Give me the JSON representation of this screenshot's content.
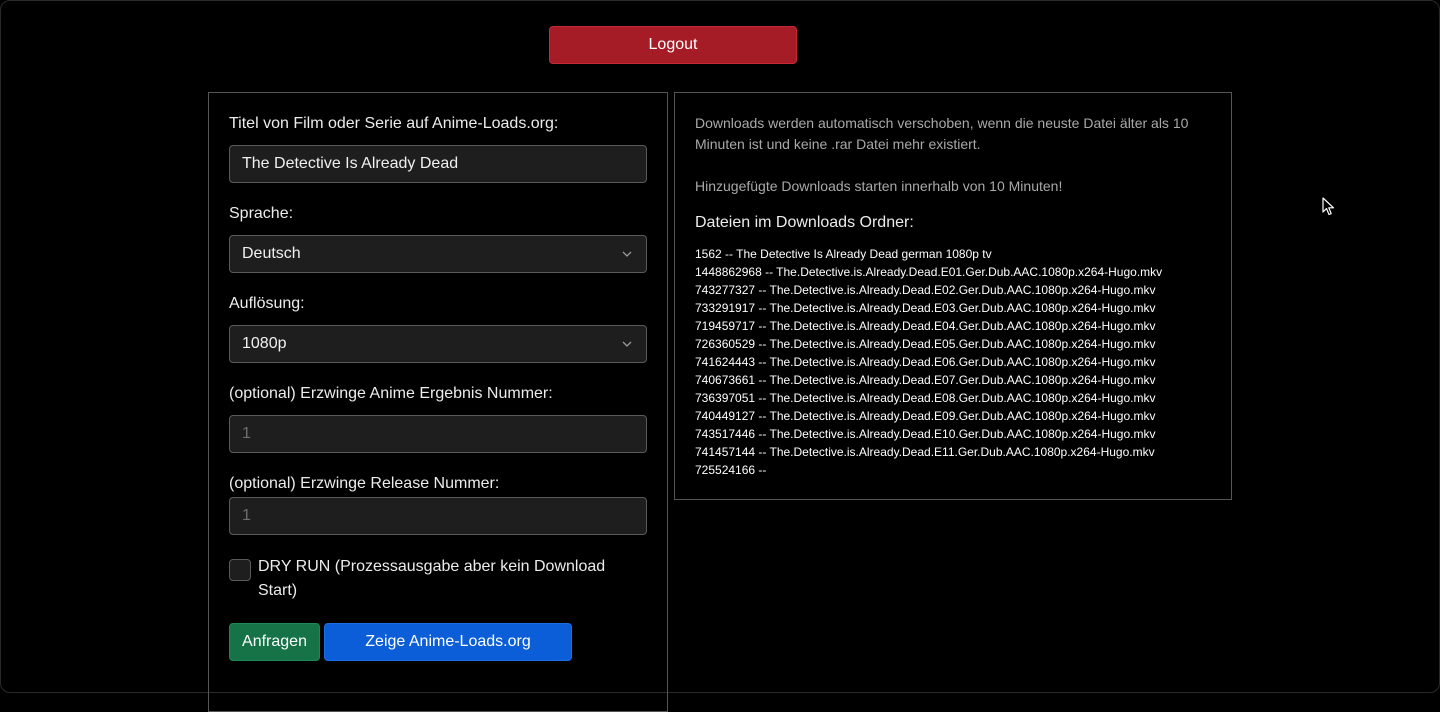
{
  "header": {
    "logout_label": "Logout"
  },
  "form": {
    "title_label": "Titel von Film oder Serie auf Anime-Loads.org:",
    "title_value": "The Detective Is Already Dead",
    "language_label": "Sprache:",
    "language_value": "Deutsch",
    "resolution_label": "Auflösung:",
    "resolution_value": "1080p",
    "anime_result_label": "(optional) Erzwinge Anime Ergebnis Nummer:",
    "anime_result_placeholder": "1",
    "release_label": "(optional) Erzwinge Release Nummer:",
    "release_placeholder": "1",
    "dry_run_label": "DRY RUN (Prozessausgabe aber kein Download Start)",
    "dry_run_checked": false,
    "submit_label": "Anfragen",
    "show_site_label": "Zeige Anime-Loads.org"
  },
  "info": {
    "move_notice": "Downloads werden automatisch verschoben, wenn die neuste Datei älter als 10 Minuten ist und keine .rar Datei mehr existiert.",
    "start_notice": "Hinzugefügte Downloads starten innerhalb von 10 Minuten!",
    "files_heading": "Dateien im Downloads Ordner:",
    "files": [
      "1562 -- The Detective Is Already Dead german 1080p tv",
      "1448862968 -- The.Detective.is.Already.Dead.E01.Ger.Dub.AAC.1080p.x264-Hugo.mkv",
      "743277327 -- The.Detective.is.Already.Dead.E02.Ger.Dub.AAC.1080p.x264-Hugo.mkv",
      "733291917 -- The.Detective.is.Already.Dead.E03.Ger.Dub.AAC.1080p.x264-Hugo.mkv",
      "719459717 -- The.Detective.is.Already.Dead.E04.Ger.Dub.AAC.1080p.x264-Hugo.mkv",
      "726360529 -- The.Detective.is.Already.Dead.E05.Ger.Dub.AAC.1080p.x264-Hugo.mkv",
      "741624443 -- The.Detective.is.Already.Dead.E06.Ger.Dub.AAC.1080p.x264-Hugo.mkv",
      "740673661 -- The.Detective.is.Already.Dead.E07.Ger.Dub.AAC.1080p.x264-Hugo.mkv",
      "736397051 -- The.Detective.is.Already.Dead.E08.Ger.Dub.AAC.1080p.x264-Hugo.mkv",
      "740449127 -- The.Detective.is.Already.Dead.E09.Ger.Dub.AAC.1080p.x264-Hugo.mkv",
      "743517446 -- The.Detective.is.Already.Dead.E10.Ger.Dub.AAC.1080p.x264-Hugo.mkv",
      "741457144 -- The.Detective.is.Already.Dead.E11.Ger.Dub.AAC.1080p.x264-Hugo.mkv",
      "725524166 --"
    ]
  },
  "colors": {
    "background": "#000000",
    "logout": "#a51b26",
    "submit": "#157347",
    "show_site": "#0b5ed7",
    "panel_border": "#555555"
  },
  "icons": {
    "select_arrow": "chevron-down-icon",
    "pointer": "mouse-cursor-icon"
  }
}
